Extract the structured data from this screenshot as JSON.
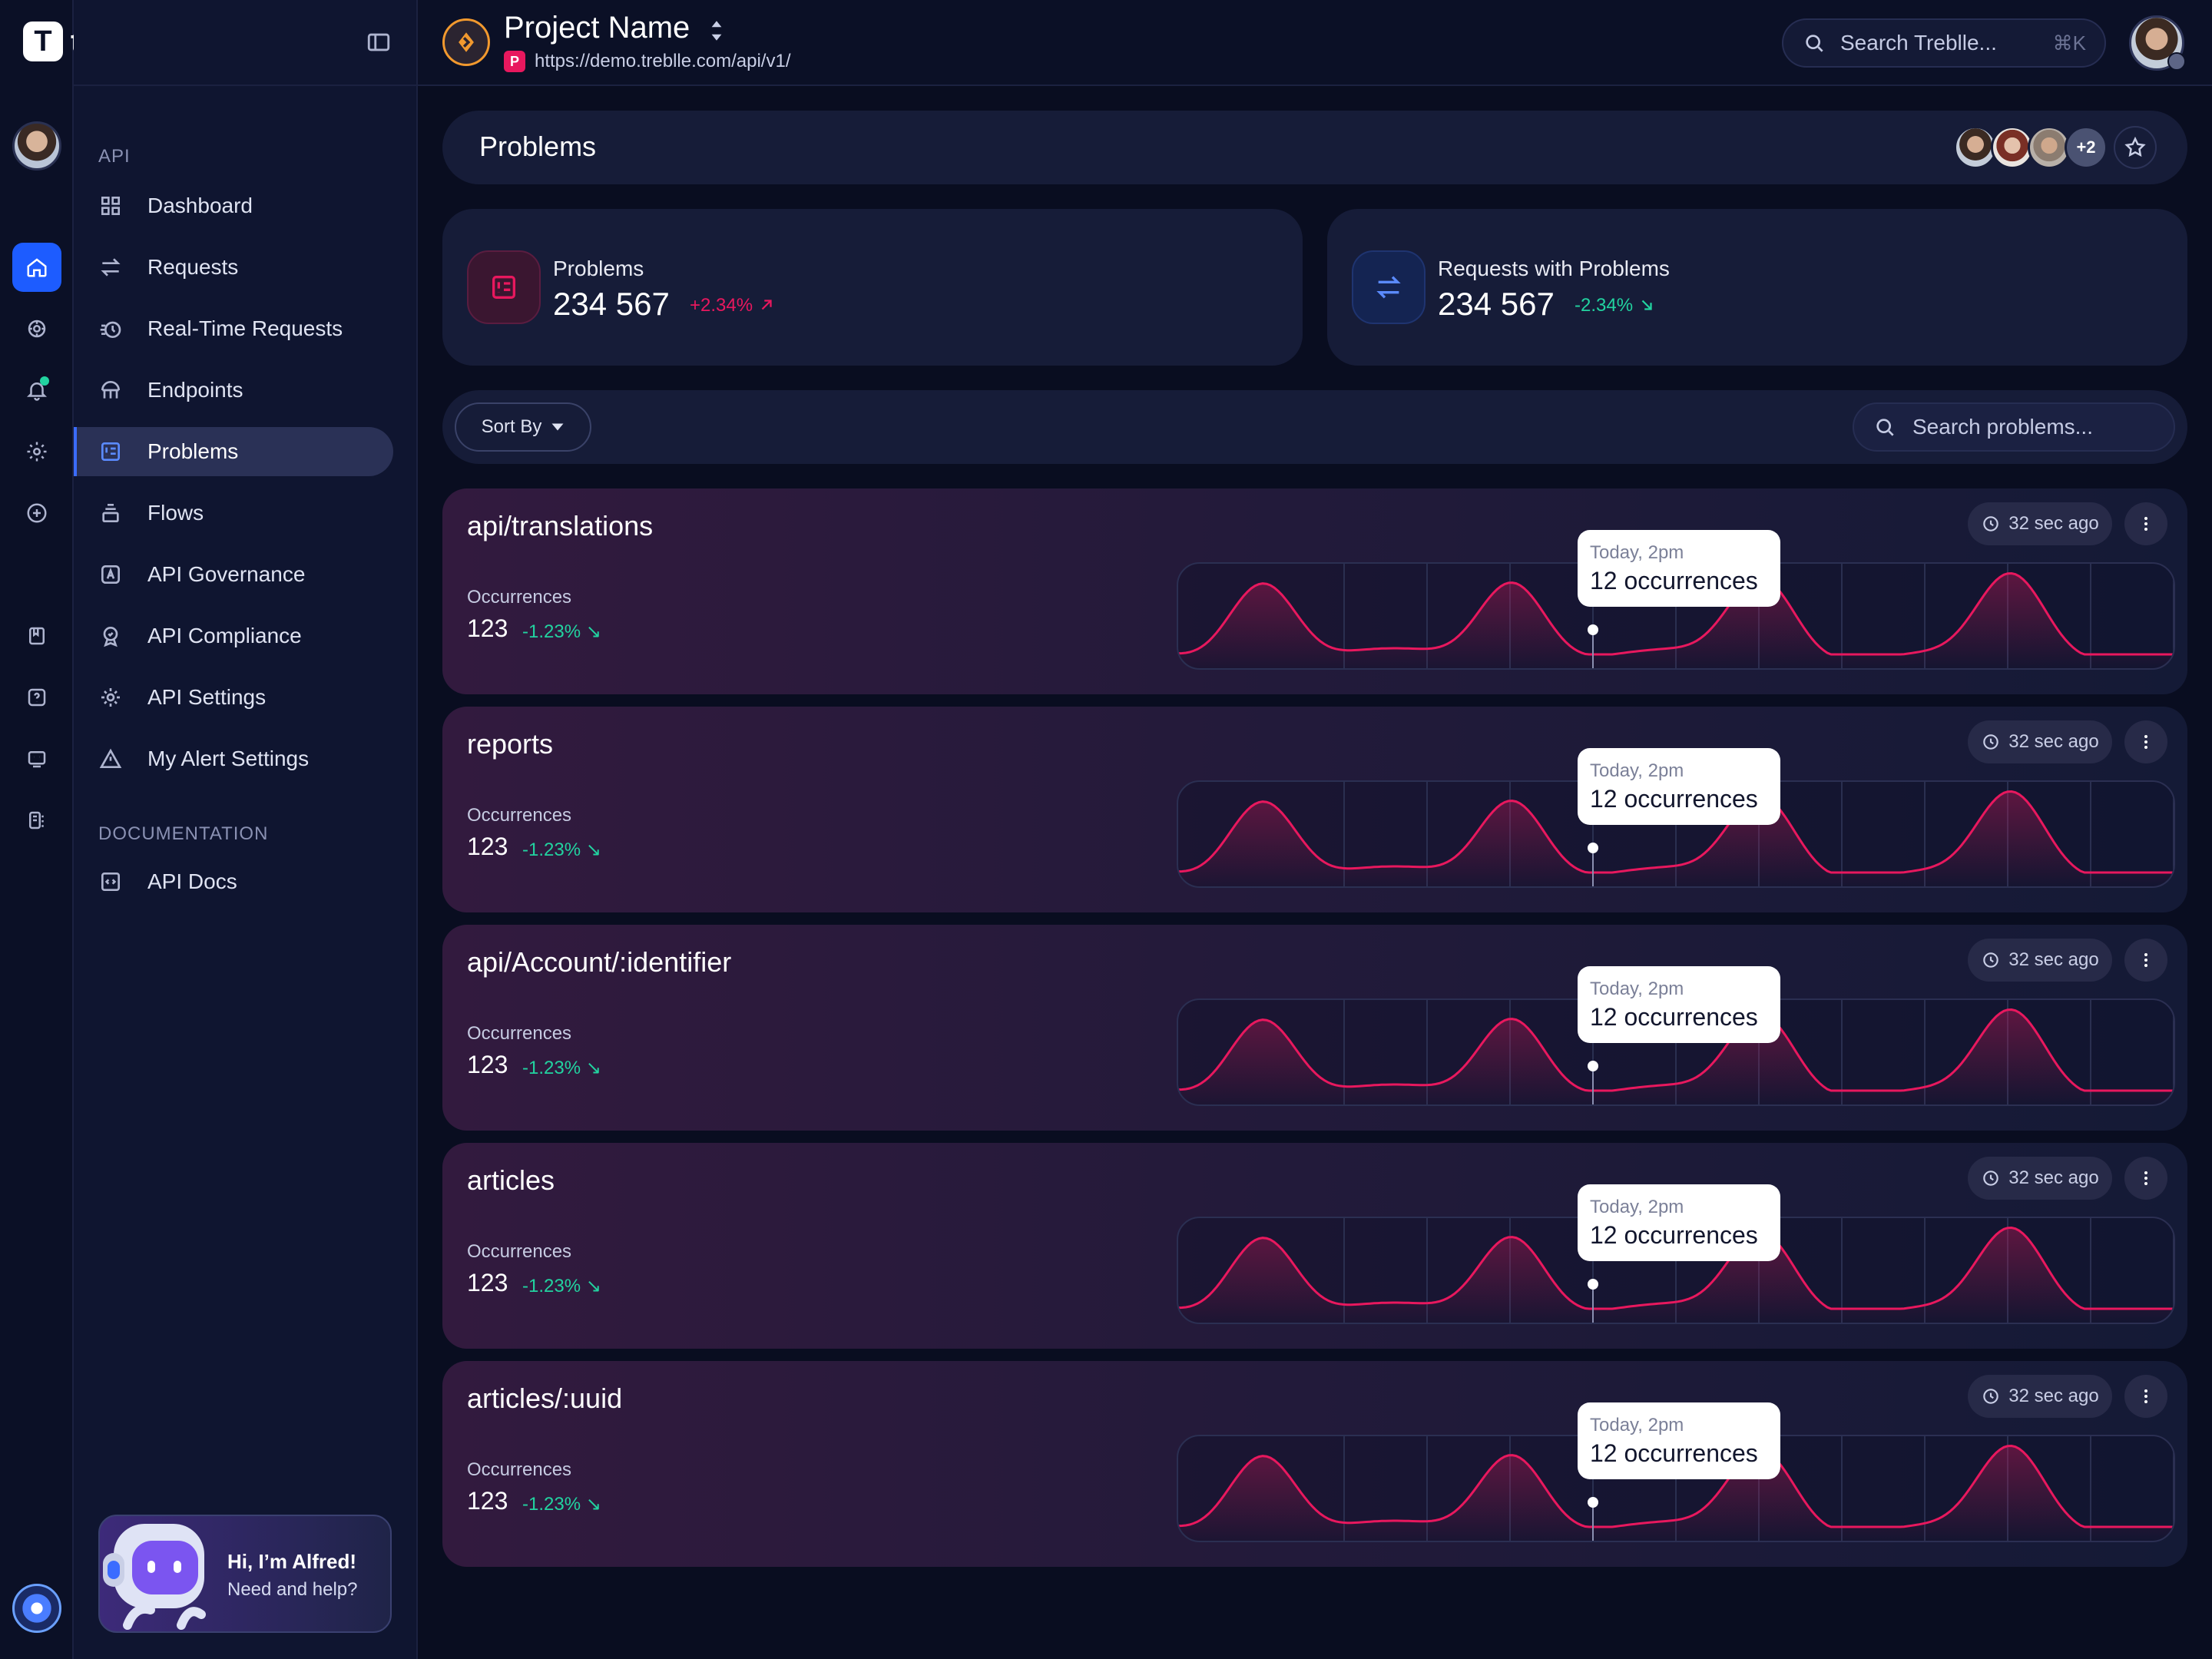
{
  "brand": {
    "name": "treblle",
    "accent": "#1d5cff",
    "danger": "#e8185e",
    "success": "#22d3a0"
  },
  "project": {
    "name": "Project Name",
    "badge": "P",
    "url": "https://demo.treblle.com/api/v1/"
  },
  "global_search": {
    "placeholder": "Search Treblle...",
    "shortcut": "⌘K"
  },
  "rail": {
    "icons": [
      "home-icon",
      "cube-icon",
      "bell-icon",
      "gear-icon",
      "plus-circle-icon",
      "book-icon",
      "help-icon",
      "chat-icon",
      "apps-icon"
    ]
  },
  "sidebar": {
    "section_api": "API",
    "items": [
      {
        "label": "Dashboard",
        "icon": "grid-icon"
      },
      {
        "label": "Requests",
        "icon": "arrows-icon"
      },
      {
        "label": "Real-Time Requests",
        "icon": "realtime-icon"
      },
      {
        "label": "Endpoints",
        "icon": "endpoints-icon"
      },
      {
        "label": "Problems",
        "icon": "problems-icon",
        "active": true
      },
      {
        "label": "Flows",
        "icon": "flows-icon"
      },
      {
        "label": "API Governance",
        "icon": "governance-icon"
      },
      {
        "label": "API Compliance",
        "icon": "compliance-icon"
      },
      {
        "label": "API Settings",
        "icon": "settings-icon"
      },
      {
        "label": "My Alert Settings",
        "icon": "alert-icon"
      }
    ],
    "section_docs": "DOCUMENTATION",
    "docs_items": [
      {
        "label": "API Docs",
        "icon": "docs-icon"
      }
    ]
  },
  "alfred": {
    "title": "Hi, I’m Alfred!",
    "subtitle": "Need and help?"
  },
  "page": {
    "title": "Problems",
    "collaborators_more": "+2"
  },
  "stats": [
    {
      "label": "Problems",
      "value": "234 567",
      "change": "+2.34%",
      "trend": "up",
      "color": "#e8185e"
    },
    {
      "label": "Requests with Problems",
      "value": "234 567",
      "change": "-2.34%",
      "trend": "down",
      "color": "#22d3a0"
    }
  ],
  "filters": {
    "sort_label": "Sort By",
    "search_placeholder": "Search problems..."
  },
  "problems": [
    {
      "name": "api/translations",
      "occ_label": "Occurrences",
      "occ_value": "123",
      "occ_change": "-1.23%",
      "time": "32 sec ago",
      "tooltip_time": "Today, 2pm",
      "tooltip_value": "12 occurrences"
    },
    {
      "name": "reports",
      "occ_label": "Occurrences",
      "occ_value": "123",
      "occ_change": "-1.23%",
      "time": "32 sec ago",
      "tooltip_time": "Today, 2pm",
      "tooltip_value": "12 occurrences"
    },
    {
      "name": "api/Account/:identifier",
      "occ_label": "Occurrences",
      "occ_value": "123",
      "occ_change": "-1.23%",
      "time": "32 sec ago",
      "tooltip_time": "Today, 2pm",
      "tooltip_value": "12 occurrences"
    },
    {
      "name": "articles",
      "occ_label": "Occurrences",
      "occ_value": "123",
      "occ_change": "-1.23%",
      "time": "32 sec ago",
      "tooltip_time": "Today, 2pm",
      "tooltip_value": "12 occurrences"
    },
    {
      "name": "articles/:uuid",
      "occ_label": "Occurrences",
      "occ_value": "123",
      "occ_change": "-1.23%",
      "time": "32 sec ago",
      "tooltip_time": "Today, 2pm",
      "tooltip_value": "12 occurrences"
    }
  ]
}
